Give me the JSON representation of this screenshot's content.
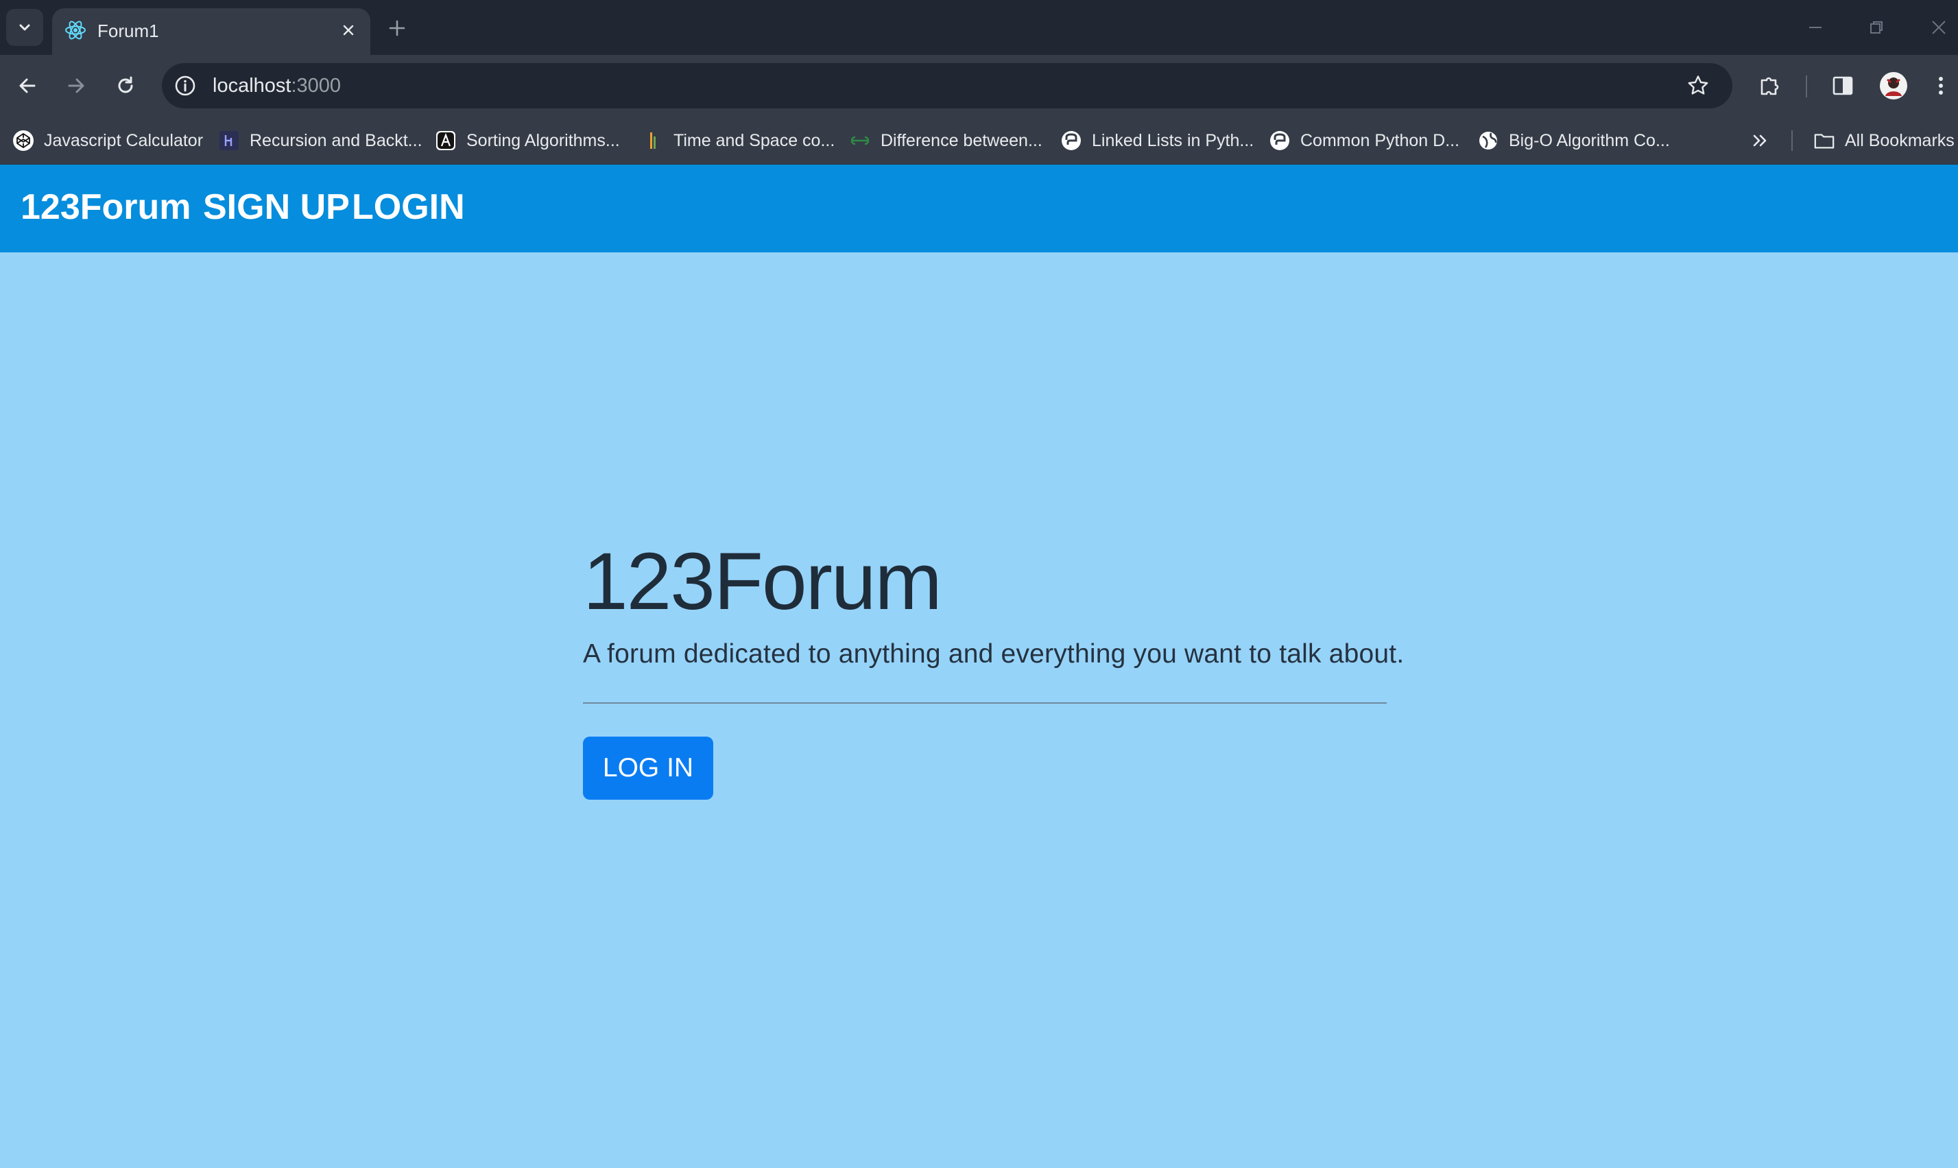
{
  "browser": {
    "tab": {
      "title": "Forum1",
      "favicon": "react-icon"
    },
    "url": {
      "host": "localhost",
      "port": ":3000"
    },
    "bookmarks": [
      {
        "label": "Javascript Calculator",
        "icon": "codepen-icon"
      },
      {
        "label": "Recursion and Backt...",
        "icon": "hackerrank-icon"
      },
      {
        "label": "Sorting Algorithms...",
        "icon": "algo-icon"
      },
      {
        "label": "Time and Space co...",
        "icon": "bars-icon"
      },
      {
        "label": "Difference between...",
        "icon": "geeks-icon"
      },
      {
        "label": "Linked Lists in Pyth...",
        "icon": "python-icon"
      },
      {
        "label": "Common Python D...",
        "icon": "python-icon"
      },
      {
        "label": "Big-O Algorithm Co...",
        "icon": "globe-icon"
      }
    ],
    "all_bookmarks_label": "All Bookmarks"
  },
  "app": {
    "brand": "123Forum",
    "nav": {
      "signup": "SIGN UP",
      "login": "LOGIN"
    },
    "hero": {
      "title": "123Forum",
      "lead": "A forum dedicated to anything and everything you want to talk about.",
      "button": "LOG IN"
    }
  },
  "colors": {
    "navbar": "#068ddd",
    "page_bg": "#96d3f9",
    "button": "#0a7cf2",
    "chrome_dark": "#212732",
    "chrome_mid": "#353c47"
  }
}
